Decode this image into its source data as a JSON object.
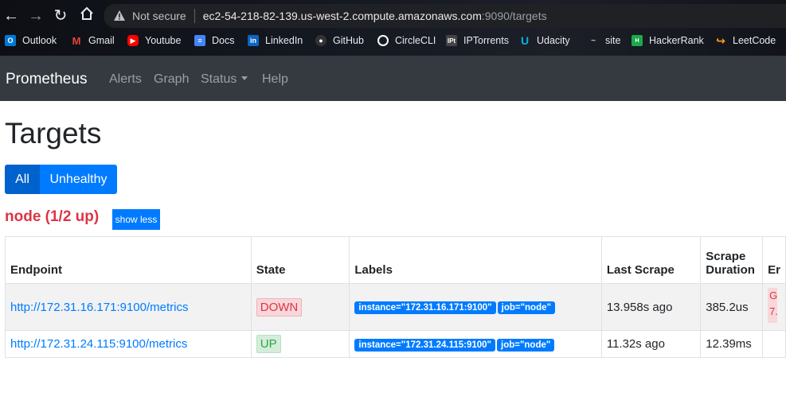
{
  "browser": {
    "not_secure": "Not secure",
    "url_host": "ec2-54-218-82-139.us-west-2.compute.amazonaws.com",
    "url_rest": ":9090/targets",
    "bookmarks": [
      {
        "label": "Outlook",
        "icon": "outlook-icon",
        "color": "#0078d4"
      },
      {
        "label": "Gmail",
        "icon": "gmail-icon",
        "color": "#ea4335"
      },
      {
        "label": "Youtube",
        "icon": "youtube-icon",
        "color": "#ff0000"
      },
      {
        "label": "Docs",
        "icon": "docs-icon",
        "color": "#4285f4"
      },
      {
        "label": "LinkedIn",
        "icon": "linkedin-icon",
        "color": "#0a66c2"
      },
      {
        "label": "GitHub",
        "icon": "github-icon",
        "color": "#ffffff"
      },
      {
        "label": "CircleCLI",
        "icon": "circleci-icon",
        "color": "#ffffff"
      },
      {
        "label": "IPTorrents",
        "icon": "iptorrents-icon",
        "color": "#444444"
      },
      {
        "label": "Udacity",
        "icon": "udacity-icon",
        "color": "#02b3e4"
      },
      {
        "label": "site",
        "icon": "site-icon",
        "color": "#cccccc"
      },
      {
        "label": "HackerRank",
        "icon": "hackerrank-icon",
        "color": "#1ba94c"
      },
      {
        "label": "LeetCode",
        "icon": "leetcode-icon",
        "color": "#ffa116"
      }
    ]
  },
  "navbar": {
    "brand": "Prometheus",
    "links": [
      "Alerts",
      "Graph",
      "Status",
      "Help"
    ]
  },
  "page": {
    "title": "Targets",
    "filter_all": "All",
    "filter_unhealthy": "Unhealthy",
    "job_title": "node (1/2 up)",
    "show_less": "show less"
  },
  "table": {
    "headers": {
      "endpoint": "Endpoint",
      "state": "State",
      "labels": "Labels",
      "last_scrape": "Last Scrape",
      "scrape_duration_1": "Scrape",
      "scrape_duration_2": "Duration",
      "error": "Er"
    },
    "rows": [
      {
        "endpoint": "http://172.31.16.171:9100/metrics",
        "state": "DOWN",
        "label_instance": "instance=\"172.31.16.171:9100\"",
        "label_job": "job=\"node\"",
        "last_scrape": "13.958s ago",
        "duration": "385.2us",
        "error": "G\n7."
      },
      {
        "endpoint": "http://172.31.24.115:9100/metrics",
        "state": "UP",
        "label_instance": "instance=\"172.31.24.115:9100\"",
        "label_job": "job=\"node\"",
        "last_scrape": "11.32s ago",
        "duration": "12.39ms",
        "error": ""
      }
    ]
  },
  "colors": {
    "accent": "#007bff",
    "danger": "#dc3545",
    "success": "#28a745",
    "navbar": "#343a40"
  }
}
